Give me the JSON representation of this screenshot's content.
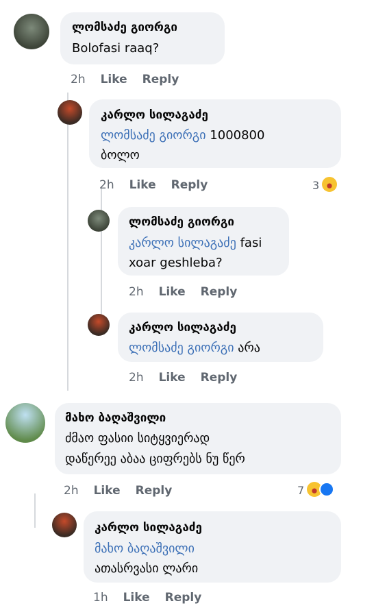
{
  "comments": [
    {
      "name": "ლომსაძე გიორგი",
      "text": "Bolofasi raaq?",
      "time": "2h",
      "like": "Like",
      "reply": "Reply"
    },
    {
      "name": "კარლო სილაგაძე",
      "mention": "ლომსაძე გიორგი",
      "text_line1_rest": "1000800",
      "text_line2": "ბოლო",
      "time": "2h",
      "like": "Like",
      "reply": "Reply",
      "reaction_count": "3"
    },
    {
      "name": "ლომსაძე გიორგი",
      "mention": "კარლო სილაგაძე",
      "text_line1_rest": "fasi",
      "text_line2": "xoar geshleba?",
      "time": "2h",
      "like": "Like",
      "reply": "Reply"
    },
    {
      "name": "კარლო სილაგაძე",
      "mention": "ლომსაძე გიორგი",
      "text_line1_rest": "არა",
      "time": "2h",
      "like": "Like",
      "reply": "Reply"
    },
    {
      "name": "მახო ბაღაშვილი",
      "text_line1": "ძმაო ფასიი სიტყვიერად",
      "text_line2": "დაწერეე აბაა ციფრებს ნუ წერ",
      "time": "2h",
      "like": "Like",
      "reply": "Reply",
      "reaction_count": "7"
    },
    {
      "name": "კარლო სილაგაძე",
      "mention": "მახო ბაღაშვილი",
      "text_line2": "ათასრვასი ლარი",
      "time": "1h",
      "like": "Like",
      "reply": "Reply"
    }
  ],
  "icons": {
    "haha": "haha-emoji",
    "like": "like-icon"
  },
  "colors": {
    "bubble": "#f0f2f5",
    "mention": "#3b6fb6",
    "meta": "#606770",
    "line": "#d6d9dd"
  }
}
